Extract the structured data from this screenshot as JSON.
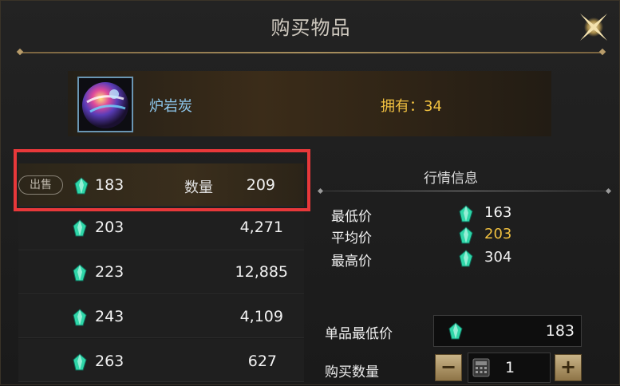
{
  "dialog": {
    "title": "购买物品"
  },
  "item": {
    "name": "炉岩炭",
    "owned_label": "拥有：",
    "owned_count": "34"
  },
  "listings": {
    "sell_badge": "出售",
    "qty_label": "数量",
    "rows": [
      {
        "price": "183",
        "quantity": "209"
      },
      {
        "price": "203",
        "quantity": "4,271"
      },
      {
        "price": "223",
        "quantity": "12,885"
      },
      {
        "price": "243",
        "quantity": "4,109"
      },
      {
        "price": "263",
        "quantity": "627"
      }
    ]
  },
  "market": {
    "title": "行情信息",
    "min_label": "最低价",
    "min_value": "163",
    "avg_label": "平均价",
    "avg_value": "203",
    "max_label": "最高价",
    "max_value": "304"
  },
  "purchase": {
    "unit_min_label": "单品最低价",
    "unit_min_value": "183",
    "buy_qty_label": "购买数量",
    "buy_qty_value": "1",
    "minus": "−",
    "plus": "+"
  },
  "colors": {
    "accent_gold": "#f0c040",
    "item_name": "#8ec8ee",
    "selection_border": "#e8383a"
  },
  "icons": [
    "close-icon",
    "gem-icon",
    "calculator-icon",
    "minus-icon",
    "plus-icon"
  ]
}
